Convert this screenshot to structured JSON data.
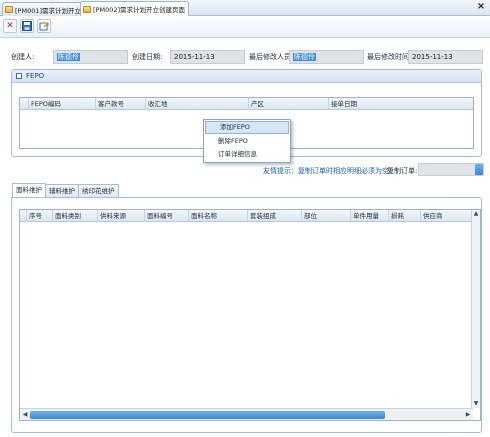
{
  "tabs": [
    {
      "label": "[PM001]需求计划开立",
      "active": false
    },
    {
      "label": "[PM002]需求计划开立创建页面",
      "active": true
    }
  ],
  "toolbar": {
    "close_icon": "x-icon",
    "save_icon": "save-icon",
    "export_icon": "export-icon"
  },
  "form": {
    "creator_label": "创建人:",
    "creator_value": "陈德伶",
    "created_date_label": "创建日期:",
    "created_date_value": "2015-11-13",
    "last_modifier_label": "最后修改人员:",
    "last_modifier_value": "陈德伶",
    "last_modified_time_label": "最后修改时间:",
    "last_modified_time_value": "2015-11-13"
  },
  "fepo": {
    "title": "FEPO",
    "columns": [
      "FEPO编码",
      "客户款号",
      "收汇地",
      "产区",
      "接单日期"
    ]
  },
  "context_menu": {
    "items": [
      "添加FEPO",
      "删除FEPO",
      "订单详细信息"
    ],
    "highlighted": 0
  },
  "notice": {
    "text": "友情提示：复制订单时相应明细必须为空！",
    "copy_order_label": "复制订单:",
    "copy_order_value": ""
  },
  "detail_tabs": {
    "items": [
      "面料维护",
      "辅料维护",
      "绣印花维护"
    ],
    "active": 0
  },
  "detail_grid": {
    "columns": [
      "序号",
      "面料类别",
      "供料来源",
      "面料编号",
      "面料名称",
      "套装组成",
      "部位",
      "单件用量",
      "损耗",
      "供应商"
    ]
  },
  "colors": {
    "accent": "#3a8ee6",
    "notice": "#1a5fb4",
    "field_bg": "#dfe2e6"
  }
}
